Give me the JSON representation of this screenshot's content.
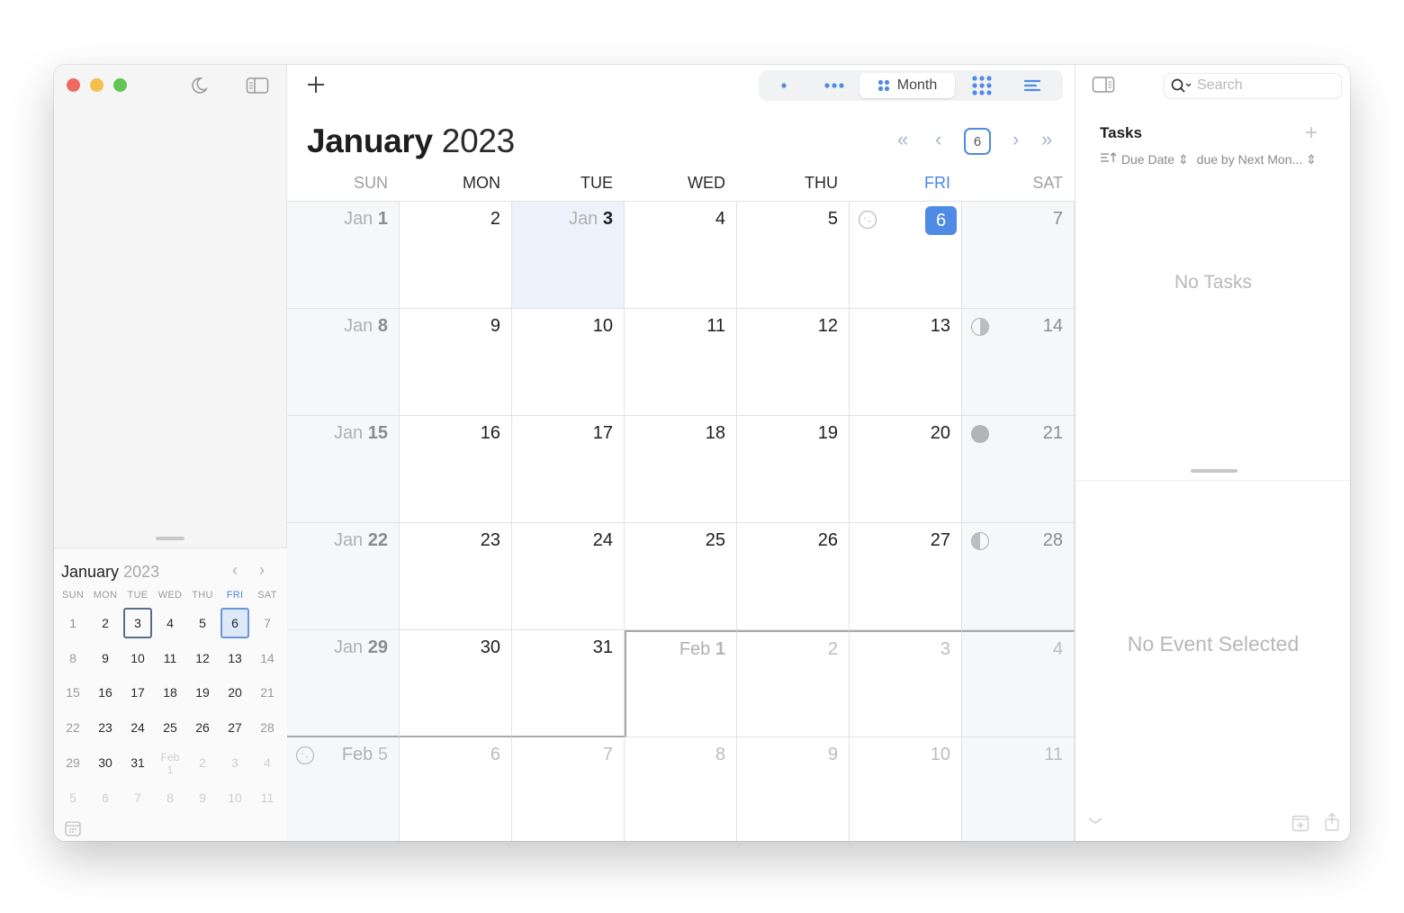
{
  "window": {
    "traffic_lights": [
      "close",
      "minimize",
      "zoom"
    ],
    "colors": {
      "accent": "#4f8ae4",
      "close": "#ec6a5e",
      "minimize": "#f4bf4f",
      "zoom": "#61c554"
    }
  },
  "sidebar": {
    "icons": [
      "moon-icon",
      "sidebar-toggle-icon"
    ],
    "mini_calendar": {
      "month": "January",
      "year": "2023",
      "days_of_week": [
        "SUN",
        "MON",
        "TUE",
        "WED",
        "THU",
        "FRI",
        "SAT"
      ],
      "highlight_dow": "FRI",
      "weeks": [
        [
          {
            "d": "1"
          },
          {
            "d": "2"
          },
          {
            "d": "3",
            "sel": "tue"
          },
          {
            "d": "4"
          },
          {
            "d": "5"
          },
          {
            "d": "6",
            "sel": "today"
          },
          {
            "d": "7"
          }
        ],
        [
          {
            "d": "8"
          },
          {
            "d": "9"
          },
          {
            "d": "10"
          },
          {
            "d": "11"
          },
          {
            "d": "12"
          },
          {
            "d": "13"
          },
          {
            "d": "14"
          }
        ],
        [
          {
            "d": "15"
          },
          {
            "d": "16"
          },
          {
            "d": "17"
          },
          {
            "d": "18"
          },
          {
            "d": "19"
          },
          {
            "d": "20"
          },
          {
            "d": "21"
          }
        ],
        [
          {
            "d": "22"
          },
          {
            "d": "23"
          },
          {
            "d": "24"
          },
          {
            "d": "25"
          },
          {
            "d": "26"
          },
          {
            "d": "27"
          },
          {
            "d": "28"
          }
        ],
        [
          {
            "d": "29"
          },
          {
            "d": "30"
          },
          {
            "d": "31"
          },
          {
            "d": "Feb\n1",
            "other": true,
            "feb": true
          },
          {
            "d": "2",
            "other": true
          },
          {
            "d": "3",
            "other": true
          },
          {
            "d": "4",
            "other": true
          }
        ],
        [
          {
            "d": "5",
            "other": true
          },
          {
            "d": "6",
            "other": true
          },
          {
            "d": "7",
            "other": true
          },
          {
            "d": "8",
            "other": true
          },
          {
            "d": "9",
            "other": true
          },
          {
            "d": "10",
            "other": true
          },
          {
            "d": "11",
            "other": true
          }
        ]
      ]
    }
  },
  "toolbar": {
    "add_label": "+",
    "views": [
      {
        "id": "day",
        "icon": "single-dot-icon"
      },
      {
        "id": "week",
        "icon": "three-dots-icon"
      },
      {
        "id": "month",
        "icon": "four-dots-icon",
        "label": "Month",
        "active": true
      },
      {
        "id": "year",
        "icon": "nine-dots-grid-icon"
      },
      {
        "id": "list",
        "icon": "list-lines-icon"
      }
    ]
  },
  "main": {
    "title_month": "January",
    "title_year": "2023",
    "nav": {
      "first": "«",
      "prev": "‹",
      "today": "6",
      "next": "›",
      "last": "»"
    },
    "days_of_week": [
      "SUN",
      "MON",
      "TUE",
      "WED",
      "THU",
      "FRI",
      "SAT"
    ],
    "weeks": [
      [
        {
          "pre": "Jan ",
          "num": "1",
          "bold": true,
          "weekend": true
        },
        {
          "num": "2"
        },
        {
          "pre": "Jan ",
          "num": "3",
          "selected": true
        },
        {
          "num": "4"
        },
        {
          "num": "5"
        },
        {
          "num": "6",
          "today": true,
          "moon": "new-moon"
        },
        {
          "num": "7",
          "weekend": true
        }
      ],
      [
        {
          "pre": "Jan ",
          "num": "8",
          "weekend": true
        },
        {
          "num": "9"
        },
        {
          "num": "10"
        },
        {
          "num": "11"
        },
        {
          "num": "12"
        },
        {
          "num": "13"
        },
        {
          "num": "14",
          "weekend": true,
          "moon": "first-quarter"
        }
      ],
      [
        {
          "pre": "Jan ",
          "num": "15",
          "weekend": true
        },
        {
          "num": "16"
        },
        {
          "num": "17"
        },
        {
          "num": "18"
        },
        {
          "num": "19"
        },
        {
          "num": "20"
        },
        {
          "num": "21",
          "weekend": true,
          "moon": "full-moon"
        }
      ],
      [
        {
          "pre": "Jan ",
          "num": "22",
          "weekend": true
        },
        {
          "num": "23"
        },
        {
          "num": "24"
        },
        {
          "num": "25"
        },
        {
          "num": "26"
        },
        {
          "num": "27"
        },
        {
          "num": "28",
          "weekend": true,
          "moon": "last-quarter"
        }
      ],
      [
        {
          "pre": "Jan ",
          "num": "29",
          "weekend": true
        },
        {
          "num": "30"
        },
        {
          "num": "31"
        },
        {
          "pre": "Feb ",
          "num": "1",
          "next": true,
          "bold": true
        },
        {
          "num": "2",
          "other": true
        },
        {
          "num": "3",
          "other": true
        },
        {
          "num": "4",
          "other": true,
          "weekend": true
        }
      ],
      [
        {
          "pre": "Feb ",
          "num": "5",
          "other": true,
          "weekend": true,
          "moon": "new-moon-outline"
        },
        {
          "num": "6",
          "other": true
        },
        {
          "num": "7",
          "other": true
        },
        {
          "num": "8",
          "other": true
        },
        {
          "num": "9",
          "other": true
        },
        {
          "num": "10",
          "other": true
        },
        {
          "num": "11",
          "other": true,
          "weekend": true
        }
      ]
    ]
  },
  "right_panel": {
    "search_placeholder": "Search",
    "tasks_title": "Tasks",
    "tasks_add": "+",
    "sort_label": "Due Date",
    "filter_label": "due by Next Mon...",
    "no_tasks": "No Tasks",
    "no_event": "No Event Selected"
  }
}
